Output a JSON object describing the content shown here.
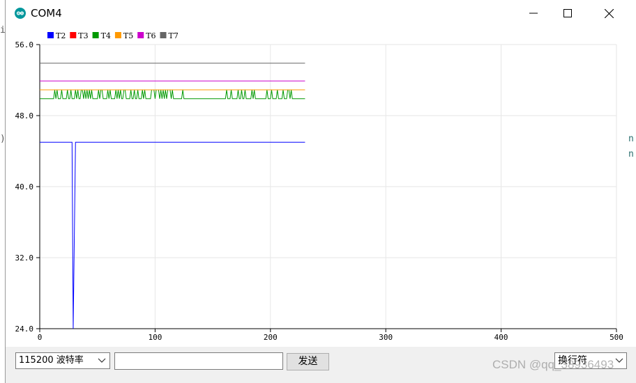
{
  "window": {
    "title": "COM4",
    "controls": {
      "minimize": "minimize-icon",
      "maximize": "maximize-icon",
      "close": "close-icon"
    }
  },
  "colors": {
    "app_icon": "#00979c",
    "T2": "#0000ff",
    "T3": "#ff0000",
    "T4": "#009900",
    "T5": "#ff9900",
    "T6": "#cc00cc",
    "T7": "#666666"
  },
  "chart_data": {
    "type": "line",
    "xlim": [
      0,
      500
    ],
    "ylim": [
      24,
      56
    ],
    "x_ticks": [
      "0",
      "100",
      "200",
      "300",
      "400",
      "500"
    ],
    "y_ticks": [
      "24.0",
      "32.0",
      "40.0",
      "48.0",
      "56.0"
    ],
    "grid": true,
    "legend": "top-left",
    "series": [
      {
        "name": "T2",
        "constant": 45,
        "end": 230,
        "dips": [
          {
            "from": 28,
            "to": 31,
            "value": 24
          }
        ]
      },
      {
        "name": "T3",
        "constant": null,
        "end": 230,
        "dips": []
      },
      {
        "name": "T4",
        "constant": 49.9,
        "alt": 50.9,
        "end": 230,
        "spikes": [
          13,
          15,
          19,
          24,
          27,
          31,
          33,
          36,
          37,
          39,
          41,
          43,
          45,
          51,
          53,
          54,
          59,
          61,
          66,
          68,
          70,
          73,
          74,
          79,
          82,
          85,
          89,
          91,
          97,
          98,
          99,
          101,
          102,
          103,
          105,
          107,
          109,
          111,
          112,
          113,
          115,
          124,
          162,
          166,
          172,
          175,
          178,
          184,
          186,
          197,
          201,
          206,
          211,
          215,
          216,
          218
        ]
      },
      {
        "name": "T5",
        "constant": 50.9,
        "end": 230,
        "dips": []
      },
      {
        "name": "T6",
        "constant": 51.9,
        "end": 230,
        "dips": []
      },
      {
        "name": "T7",
        "constant": 53.9,
        "end": 230,
        "dips": []
      }
    ]
  },
  "bottom_bar": {
    "baud_rate": "115200  波特率",
    "send_input_value": "",
    "send_button": "发送",
    "line_ending": "换行符"
  },
  "watermark": "CSDN @qq_38936493",
  "background_fragments": {
    "left_1": "i",
    "left_2": ")",
    "right_1": "n",
    "right_2": "n"
  }
}
